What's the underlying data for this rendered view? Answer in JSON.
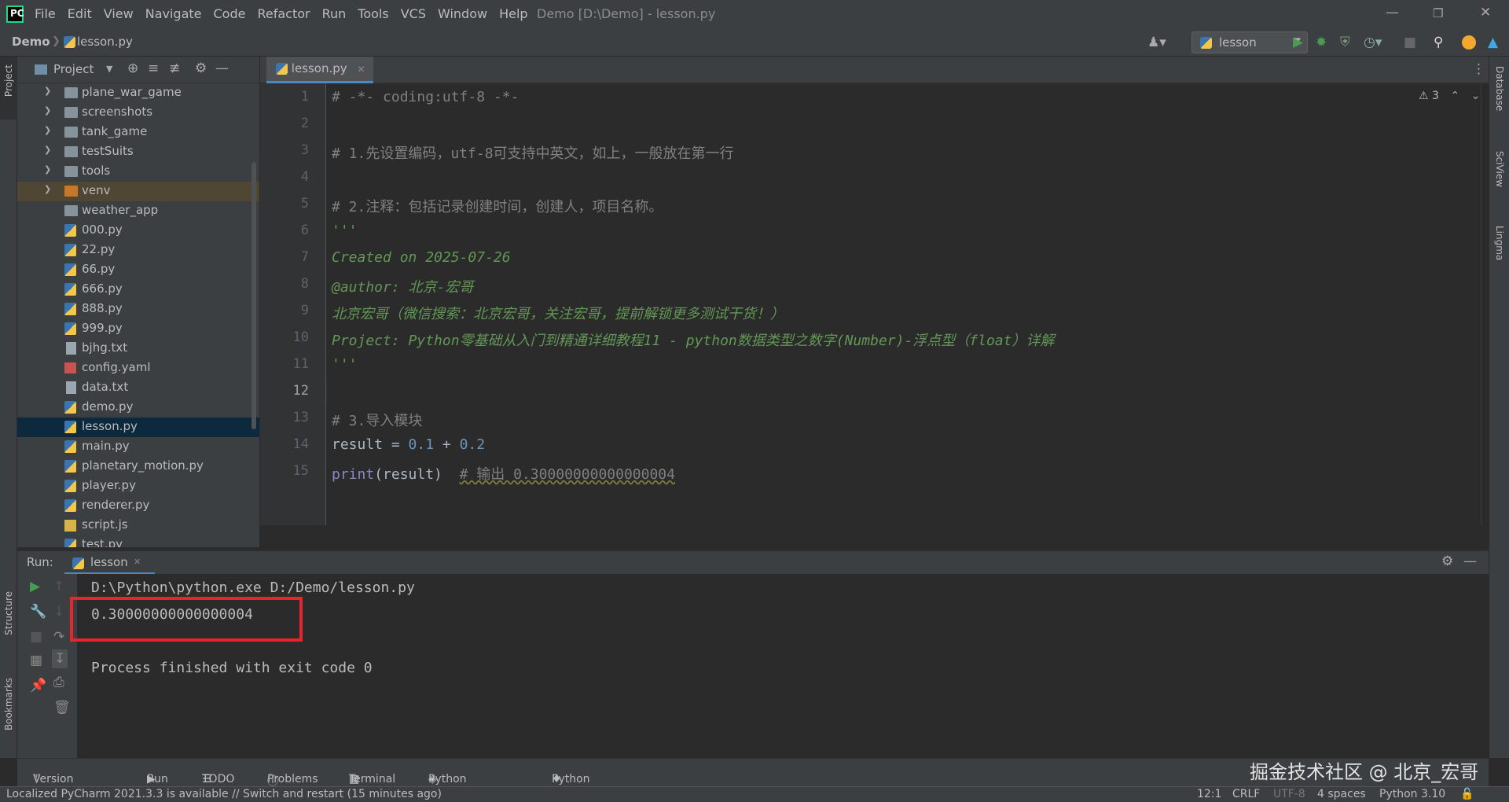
{
  "menubar": {
    "items": [
      "File",
      "Edit",
      "View",
      "Navigate",
      "Code",
      "Refactor",
      "Run",
      "Tools",
      "VCS",
      "Window",
      "Help"
    ],
    "window_title": "Demo [D:\\Demo] - lesson.py"
  },
  "navbar": {
    "project": "Demo",
    "file": "lesson.py",
    "run_config": "lesson"
  },
  "project_panel": {
    "title": "Project",
    "items": [
      {
        "label": "plane_war_game",
        "type": "folder"
      },
      {
        "label": "screenshots",
        "type": "folder"
      },
      {
        "label": "tank_game",
        "type": "folder"
      },
      {
        "label": "testSuits",
        "type": "folder"
      },
      {
        "label": "tools",
        "type": "folder"
      },
      {
        "label": "venv",
        "type": "folder-excluded"
      },
      {
        "label": "weather_app",
        "type": "folder"
      },
      {
        "label": "000.py",
        "type": "py"
      },
      {
        "label": "22.py",
        "type": "py"
      },
      {
        "label": "66.py",
        "type": "py"
      },
      {
        "label": "666.py",
        "type": "py"
      },
      {
        "label": "888.py",
        "type": "py"
      },
      {
        "label": "999.py",
        "type": "py"
      },
      {
        "label": "bjhg.txt",
        "type": "txt"
      },
      {
        "label": "config.yaml",
        "type": "yaml"
      },
      {
        "label": "data.txt",
        "type": "txt"
      },
      {
        "label": "demo.py",
        "type": "py"
      },
      {
        "label": "lesson.py",
        "type": "py",
        "selected": true
      },
      {
        "label": "main.py",
        "type": "py"
      },
      {
        "label": "planetary_motion.py",
        "type": "py"
      },
      {
        "label": "player.py",
        "type": "py"
      },
      {
        "label": "renderer.py",
        "type": "py"
      },
      {
        "label": "script.js",
        "type": "js"
      },
      {
        "label": "test.py",
        "type": "py"
      }
    ]
  },
  "editor": {
    "tab": "lesson.py",
    "inspection_count": "3",
    "line_numbers": [
      "1",
      "2",
      "3",
      "4",
      "5",
      "6",
      "7",
      "8",
      "9",
      "10",
      "11",
      "12",
      "13",
      "14",
      "15"
    ],
    "current_line": "12",
    "lines": {
      "l1": "# -*- coding:utf-8 -*-",
      "l3": "# 1.先设置编码，utf-8可支持中英文，如上，一般放在第一行",
      "l5": "# 2.注释：包括记录创建时间，创建人，项目名称。",
      "l6": "'''",
      "l7": "Created on 2025-07-26",
      "l8": "@author: 北京-宏哥",
      "l9": "北京宏哥（微信搜索：北京宏哥，关注宏哥，提前解锁更多测试干货！）",
      "l10": "Project: Python零基础从入门到精通详细教程11 - python数据类型之数字(Number)-浮点型（float）详解",
      "l11": "'''",
      "l13": "# 3.导入模块",
      "l14_var": "result = ",
      "l14_a": "0.1",
      "l14_op": " + ",
      "l14_b": "0.2",
      "l15_fn": "print",
      "l15_arg": "(result)  ",
      "l15_cmt": "# 输出 0.30000000000000004"
    }
  },
  "run_panel": {
    "label": "Run:",
    "tab": "lesson",
    "output": [
      "D:\\Python\\python.exe D:/Demo/lesson.py",
      "0.30000000000000004",
      "",
      "Process finished with exit code 0"
    ]
  },
  "left_strip": {
    "project": "Project",
    "structure": "Structure",
    "bookmarks": "Bookmarks"
  },
  "right_strip": {
    "database": "Database",
    "sciview": "SciView",
    "lingma": "Lingma"
  },
  "tool_tabs": [
    "Version Control",
    "Run",
    "TODO",
    "Problems",
    "Terminal",
    "Python Packages",
    "Python Console"
  ],
  "status": {
    "message": "Localized PyCharm 2021.3.3 is available // Switch and restart (15 minutes ago)",
    "position": "12:1",
    "line_sep": "CRLF",
    "encoding": "UTF-8",
    "indent": "4 spaces",
    "interpreter": "Python 3.10"
  },
  "watermark": "掘金技术社区 @ 北京_宏哥",
  "colors": {
    "accent": "#4a88c7",
    "highlight_box": "#e8252b",
    "run_green": "#499c54"
  }
}
